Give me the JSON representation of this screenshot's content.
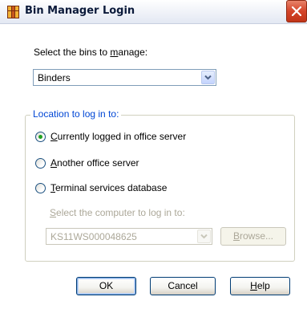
{
  "window": {
    "title": "Bin Manager Login",
    "icon": "bin-manager-app-icon",
    "close_icon": "close-icon"
  },
  "bins": {
    "label_prefix": "Select the bins to ",
    "label_accel": "m",
    "label_suffix": "anage:",
    "selected": "Binders"
  },
  "location": {
    "legend": "Location to log in to:",
    "options": [
      {
        "accel": "C",
        "rest": "urrently logged in office server",
        "selected": true
      },
      {
        "accel": "A",
        "rest": "nother office server",
        "selected": false
      },
      {
        "accel": "T",
        "rest": "erminal services database",
        "selected": false
      }
    ],
    "computer_label_accel": "S",
    "computer_label_rest": "elect the computer to log in to:",
    "computer_value": "KS11WS000048625",
    "browse_accel": "B",
    "browse_rest": "rowse..."
  },
  "buttons": {
    "ok": "OK",
    "cancel": "Cancel",
    "help_accel": "H",
    "help_rest": "elp"
  },
  "colors": {
    "accent": "#0046d5",
    "title_close": "#d4452a",
    "radio_dot": "#21a121"
  }
}
